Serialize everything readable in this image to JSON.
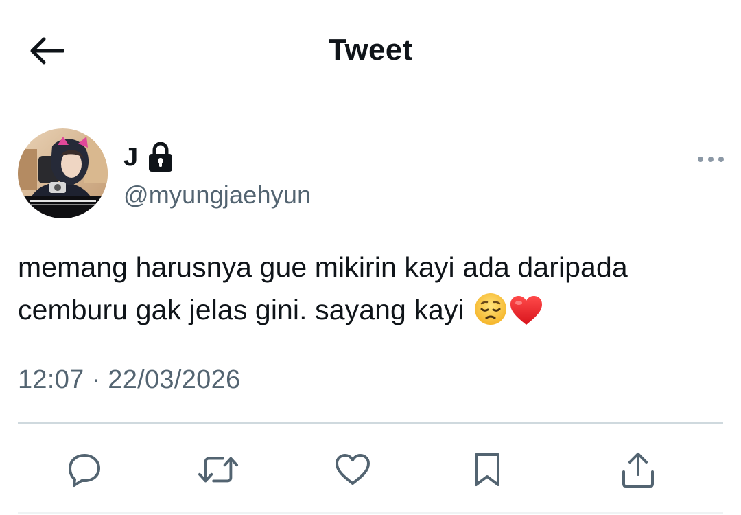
{
  "header": {
    "title": "Tweet",
    "back_icon": "arrow-left-icon"
  },
  "author": {
    "display_name": "J",
    "protected_icon": "lock-icon",
    "handle": "@myungjaehyun",
    "avatar_icon": "profile-photo"
  },
  "tweet": {
    "text_line_1": "memang harusnya gue mikirin kayi ada daripada",
    "text_line_2": "cemburu gak jelas gini. sayang kayi ",
    "emojis": [
      "pensive-face-emoji",
      "red-heart-emoji"
    ],
    "timestamp": "12:07 · 22/03/2026"
  },
  "actions": [
    {
      "icon": "reply-icon"
    },
    {
      "icon": "retweet-icon"
    },
    {
      "icon": "like-icon"
    },
    {
      "icon": "bookmark-icon"
    },
    {
      "icon": "share-icon"
    }
  ],
  "colors": {
    "text": "#0f1419",
    "secondary": "#536471",
    "divider": "#cfd9de"
  }
}
